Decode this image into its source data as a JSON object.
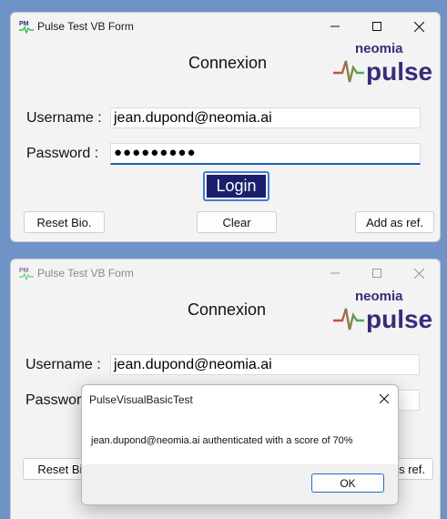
{
  "window1": {
    "title": "Pulse Test VB Form",
    "heading": "Connexion",
    "logo": {
      "brand_top": "neomia",
      "brand_main": "pulse"
    },
    "username_label": "Username :",
    "username_value": "jean.dupond@neomia.ai",
    "password_label": "Password :",
    "password_value": "●●●●●●●●●",
    "login_label": "Login",
    "reset_label": "Reset Bio.",
    "clear_label": "Clear",
    "add_ref_label": "Add as ref."
  },
  "window2": {
    "title": "Pulse Test VB Form",
    "heading": "Connexion",
    "logo": {
      "brand_top": "neomia",
      "brand_main": "pulse"
    },
    "username_label": "Username :",
    "username_value": "jean.dupond@neomia.ai",
    "password_label_partial": "Password",
    "reset_label_partial": "Reset Bio",
    "add_ref_label_partial": "s ref."
  },
  "dialog": {
    "title": "PulseVisualBasicTest",
    "message": "jean.dupond@neomia.ai authenticated with a score of 70%",
    "ok_label": "OK"
  },
  "colors": {
    "desktop": "#6f93c7",
    "login_button": "#1b1f6b",
    "logo_purple": "#3b2a7a",
    "logo_wave_start": "#e83b3b",
    "logo_wave_end": "#2fbf5a",
    "focus_accent": "#1f5fa8"
  },
  "icons": [
    "app-icon",
    "minimize-icon",
    "maximize-icon",
    "close-icon",
    "pulse-wave-icon"
  ]
}
